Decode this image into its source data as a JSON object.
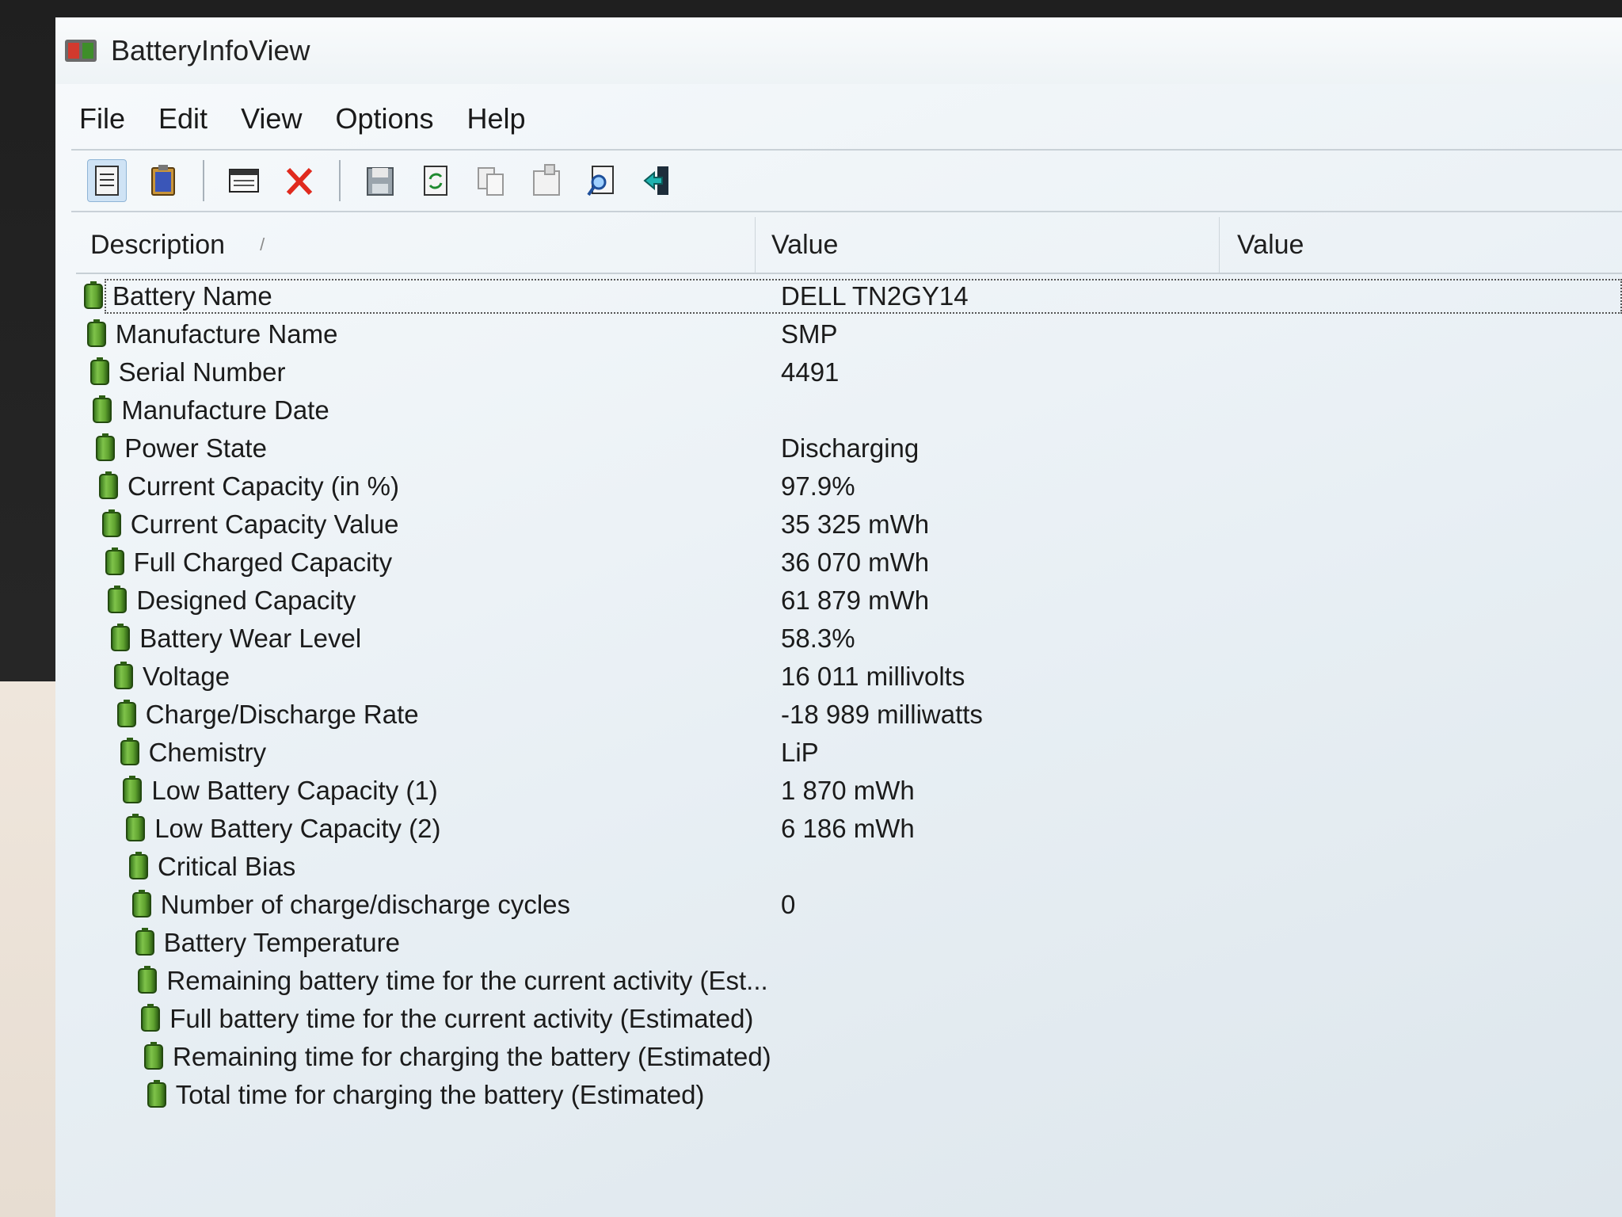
{
  "window": {
    "title": "BatteryInfoView"
  },
  "menu": [
    "File",
    "Edit",
    "View",
    "Options",
    "Help"
  ],
  "toolbar": {
    "buttons": [
      "properties-icon",
      "clipboard-icon",
      "html-report-icon",
      "close-icon",
      "save-icon",
      "refresh-icon",
      "copy-icon",
      "properties-dialog-icon",
      "find-icon",
      "exit-icon"
    ]
  },
  "columns": {
    "description": "Description",
    "value1": "Value",
    "value2": "Value"
  },
  "rows": [
    {
      "desc": "Battery Name",
      "value": "DELL TN2GY14"
    },
    {
      "desc": "Manufacture Name",
      "value": "SMP"
    },
    {
      "desc": "Serial Number",
      "value": "4491"
    },
    {
      "desc": "Manufacture Date",
      "value": ""
    },
    {
      "desc": "Power State",
      "value": "Discharging"
    },
    {
      "desc": "Current Capacity (in %)",
      "value": "97.9%"
    },
    {
      "desc": "Current Capacity Value",
      "value": "35 325 mWh"
    },
    {
      "desc": "Full Charged Capacity",
      "value": "36 070 mWh"
    },
    {
      "desc": "Designed Capacity",
      "value": "61 879 mWh"
    },
    {
      "desc": "Battery Wear Level",
      "value": "58.3%"
    },
    {
      "desc": "Voltage",
      "value": "16 011 millivolts"
    },
    {
      "desc": "Charge/Discharge Rate",
      "value": "-18 989 milliwatts"
    },
    {
      "desc": "Chemistry",
      "value": "LiP"
    },
    {
      "desc": "Low Battery Capacity (1)",
      "value": "1 870 mWh"
    },
    {
      "desc": "Low Battery Capacity (2)",
      "value": "6 186 mWh"
    },
    {
      "desc": "Critical Bias",
      "value": ""
    },
    {
      "desc": "Number of charge/discharge cycles",
      "value": "0"
    },
    {
      "desc": "Battery Temperature",
      "value": ""
    },
    {
      "desc": "Remaining battery time for the current activity (Est...",
      "value": ""
    },
    {
      "desc": "Full battery time for the current activity (Estimated)",
      "value": ""
    },
    {
      "desc": "Remaining time for charging the battery (Estimated)",
      "value": ""
    },
    {
      "desc": "Total  time for charging the battery (Estimated)",
      "value": ""
    }
  ],
  "selected_row": 0
}
